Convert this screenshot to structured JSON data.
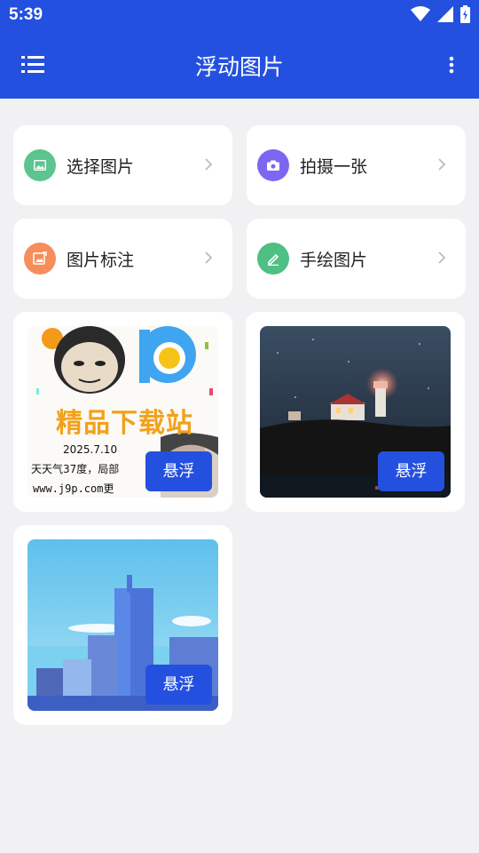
{
  "status": {
    "time": "5:39"
  },
  "appbar": {
    "title": "浮动图片",
    "menu_icon": "menu-icon",
    "more_icon": "more-vert-icon"
  },
  "actions": [
    {
      "label": "选择图片",
      "icon": "image-icon",
      "color": "#5cc48f"
    },
    {
      "label": "拍摄一张",
      "icon": "camera-icon",
      "color": "#7d66f0"
    },
    {
      "label": "图片标注",
      "icon": "annotate-icon",
      "color": "#f68e5c"
    },
    {
      "label": "手绘图片",
      "icon": "pen-icon",
      "color": "#4ec083"
    }
  ],
  "images": [
    {
      "float_label": "悬浮",
      "banner_text": "精品下载站",
      "date_text": "2025.7.10",
      "weather_text": "天天气37度，局部",
      "url_text": "www.j9p.com更"
    },
    {
      "float_label": "悬浮"
    },
    {
      "float_label": "悬浮"
    }
  ]
}
